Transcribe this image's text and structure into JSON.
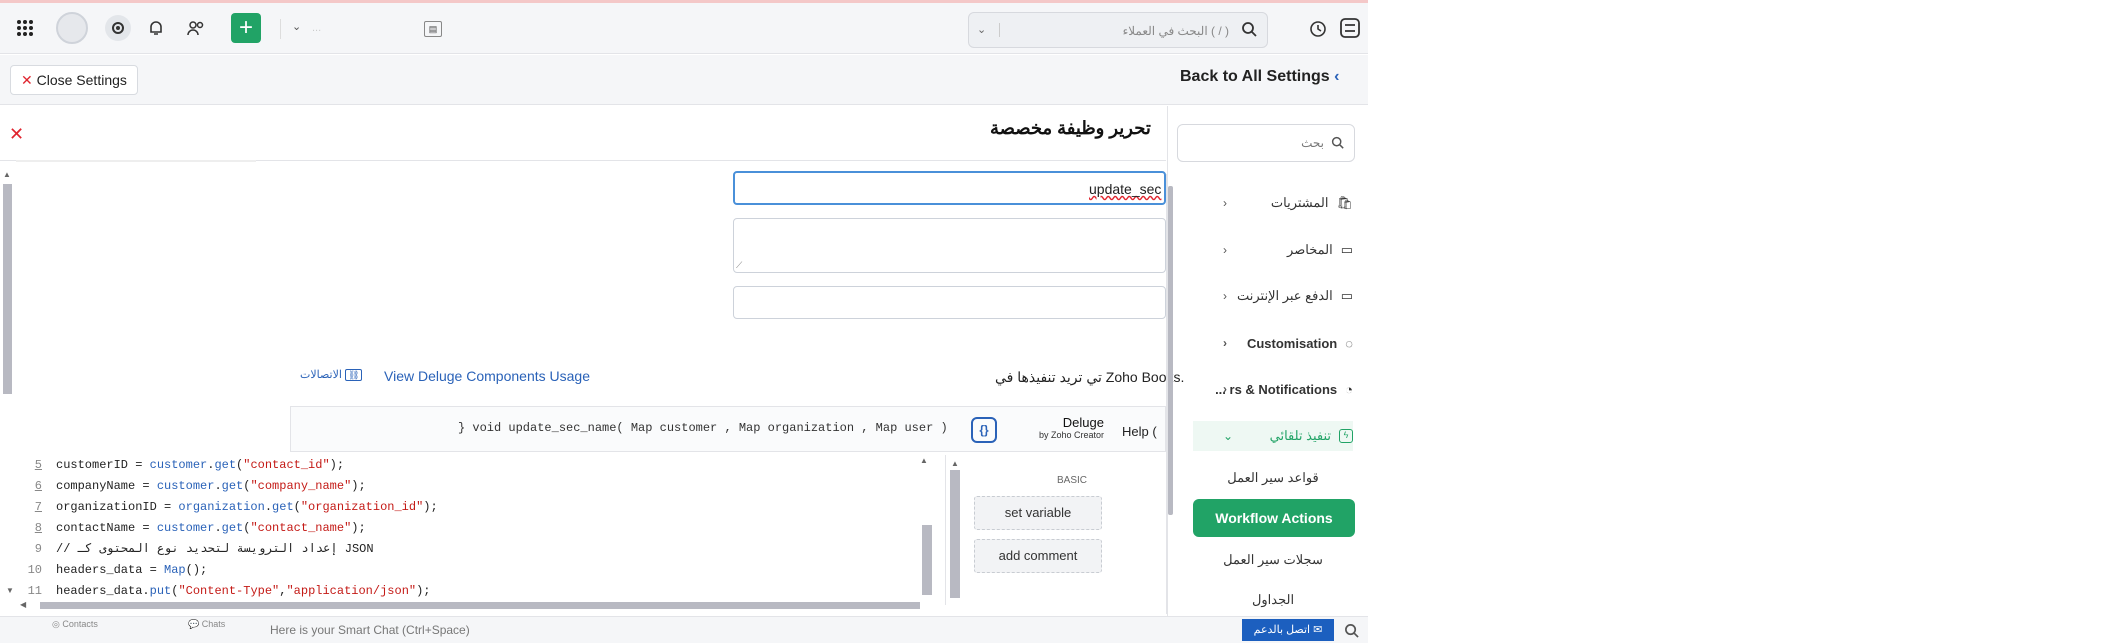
{
  "topbar": {
    "search_placeholder": "البحث في العملاء ( / )",
    "org_label": "..."
  },
  "settings": {
    "close_label": "Close Settings",
    "back_label": "Back to All Settings"
  },
  "sidebar": {
    "search_placeholder": "بحث",
    "items": [
      {
        "label": "المشتريات"
      },
      {
        "label": "المخاصر"
      },
      {
        "label": "الدفع عبر الإنترنت"
      },
      {
        "label": "Customisation"
      },
      {
        "label": "... rs & Notifications"
      },
      {
        "label": "تنفيذ تلقائي"
      },
      {
        "label": "قواعد سير العمل"
      },
      {
        "label": "Workflow Actions"
      },
      {
        "label": "سجلات سير العمل"
      },
      {
        "label": "الجداول"
      }
    ]
  },
  "editor": {
    "title": "تحرير وظيفة مخصصة",
    "name_value": "update_sec",
    "hint_text": "تي تريد تنفيذها في Zoho Books.",
    "components_link": "View Deluge Components Usage",
    "connections_link": "الاتصالات",
    "deluge_brand": "Deluge",
    "deluge_sub": "by Zoho Creator",
    "help_label": "Help (",
    "signature": "} void update_sec_name( Map customer , Map organization , Map user )",
    "code_lines": [
      {
        "n": "5",
        "parts": [
          [
            "plain",
            "customerID = "
          ],
          [
            "kw",
            "customer"
          ],
          [
            "plain",
            "."
          ],
          [
            "kw",
            "get"
          ],
          [
            "plain",
            "("
          ],
          [
            "str",
            "\"contact_id\""
          ],
          [
            "plain",
            ");"
          ]
        ]
      },
      {
        "n": "6",
        "parts": [
          [
            "plain",
            "companyName = "
          ],
          [
            "kw",
            "customer"
          ],
          [
            "plain",
            "."
          ],
          [
            "kw",
            "get"
          ],
          [
            "plain",
            "("
          ],
          [
            "str",
            "\"company_name\""
          ],
          [
            "plain",
            ");"
          ]
        ]
      },
      {
        "n": "7",
        "parts": [
          [
            "plain",
            "organizationID = "
          ],
          [
            "kw",
            "organization"
          ],
          [
            "plain",
            "."
          ],
          [
            "kw",
            "get"
          ],
          [
            "plain",
            "("
          ],
          [
            "str",
            "\"organization_id\""
          ],
          [
            "plain",
            ");"
          ]
        ]
      },
      {
        "n": "8",
        "parts": [
          [
            "plain",
            "contactName = "
          ],
          [
            "kw",
            "customer"
          ],
          [
            "plain",
            "."
          ],
          [
            "kw",
            "get"
          ],
          [
            "plain",
            "("
          ],
          [
            "str",
            "\"contact_name\""
          ],
          [
            "plain",
            ");"
          ]
        ]
      },
      {
        "n": "9",
        "parts": [
          [
            "plain",
            "// إعداد الترويسة لتحديد نوع المحتوى كـ JSON"
          ]
        ]
      },
      {
        "n": "10",
        "parts": [
          [
            "plain",
            "headers_data = "
          ],
          [
            "kw",
            "Map"
          ],
          [
            "plain",
            "();"
          ]
        ]
      },
      {
        "n": "11",
        "parts": [
          [
            "plain",
            "headers_data."
          ],
          [
            "kw",
            "put"
          ],
          [
            "plain",
            "("
          ],
          [
            "str",
            "\"Content-Type\""
          ],
          [
            "plain",
            ","
          ],
          [
            "str",
            "\"application/json\""
          ],
          [
            "plain",
            ");"
          ]
        ]
      }
    ],
    "palette_heading": "BASIC",
    "palette_items": [
      "set variable",
      "add comment"
    ]
  },
  "bottombar": {
    "contacts_label": "Contacts",
    "chats_label": "Chats",
    "smartchat_placeholder": "Here is your Smart Chat (Ctrl+Space)",
    "contact_support": "اتصل بالدعم"
  },
  "colors": {
    "accent": "#21a366",
    "close_red": "#e0242e",
    "link_blue": "#2a62b8"
  }
}
